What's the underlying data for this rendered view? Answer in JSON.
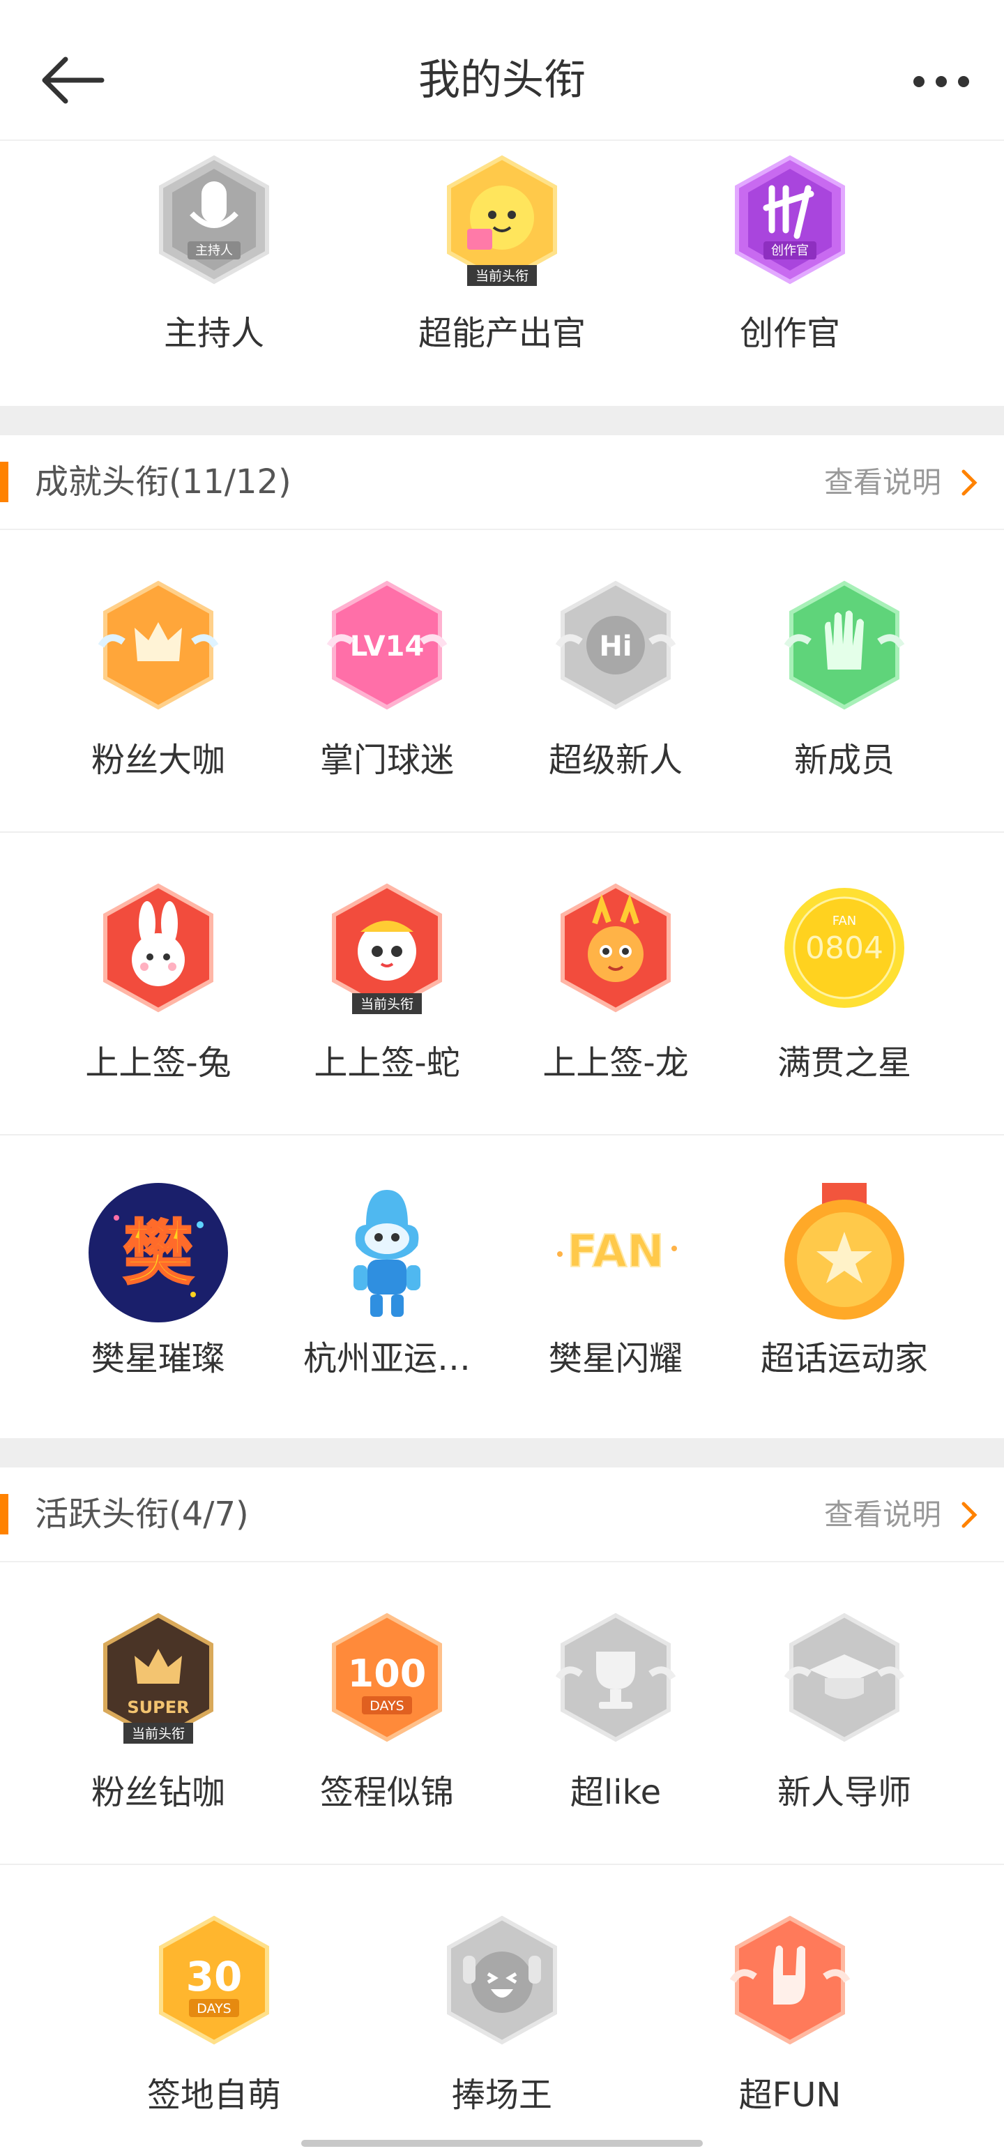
{
  "header": {
    "title": "我的头衔"
  },
  "top_badges": [
    {
      "label": "主持人",
      "icon": "host-mic-icon",
      "ribbon": "主持人"
    },
    {
      "label": "超能产出官",
      "icon": "super-producer-icon",
      "tag": "当前头衔"
    },
    {
      "label": "创作官",
      "icon": "creator-icon",
      "ribbon": "创作官"
    }
  ],
  "achievement": {
    "title": "成就头衔(11/12)",
    "link": "查看说明",
    "items": [
      {
        "label": "粉丝大咖",
        "icon": "crown-wings-icon"
      },
      {
        "label": "掌门球迷",
        "icon": "lv14-icon",
        "text": "LV14"
      },
      {
        "label": "超级新人",
        "icon": "hi-icon",
        "text": "Hi"
      },
      {
        "label": "新成员",
        "icon": "hand-icon"
      },
      {
        "label": "上上签-兔",
        "icon": "rabbit-icon"
      },
      {
        "label": "上上签-蛇",
        "icon": "snake-icon",
        "tag": "当前头衔"
      },
      {
        "label": "上上签-龙",
        "icon": "dragon-icon"
      },
      {
        "label": "满贯之星",
        "icon": "fan-0804-coin-icon",
        "text": "0804",
        "small": "FAN"
      },
      {
        "label": "樊星璀璨",
        "icon": "fan-star-icon",
        "text": "樊"
      },
      {
        "label": "杭州亚运…",
        "icon": "asian-games-mascot-icon"
      },
      {
        "label": "樊星闪耀",
        "icon": "fan-text-icon",
        "text": "FAN"
      },
      {
        "label": "超话运动家",
        "icon": "sports-medal-icon"
      }
    ]
  },
  "activity": {
    "title": "活跃头衔(4/7)",
    "link": "查看说明",
    "items": [
      {
        "label": "粉丝钻咖",
        "icon": "super-crown-icon",
        "text": "SUPER",
        "tag": "当前头衔"
      },
      {
        "label": "签程似锦",
        "icon": "100-days-icon",
        "text": "100",
        "small": "DAYS"
      },
      {
        "label": "超like",
        "icon": "trophy-icon"
      },
      {
        "label": "新人导师",
        "icon": "grad-cap-icon"
      },
      {
        "label": "签地自萌",
        "icon": "30-days-icon",
        "text": "30",
        "small": "DAYS"
      },
      {
        "label": "捧场王",
        "icon": "cheering-face-icon"
      },
      {
        "label": "超FUN",
        "icon": "rock-hand-icon"
      }
    ]
  },
  "colors": {
    "accent": "#ff8200",
    "gray_badge": "#b8b8b8",
    "orange": "#ffa63a",
    "pink": "#ff6fa8",
    "green": "#5fd47a",
    "red": "#f24c3d",
    "gold": "#ffd21f"
  }
}
